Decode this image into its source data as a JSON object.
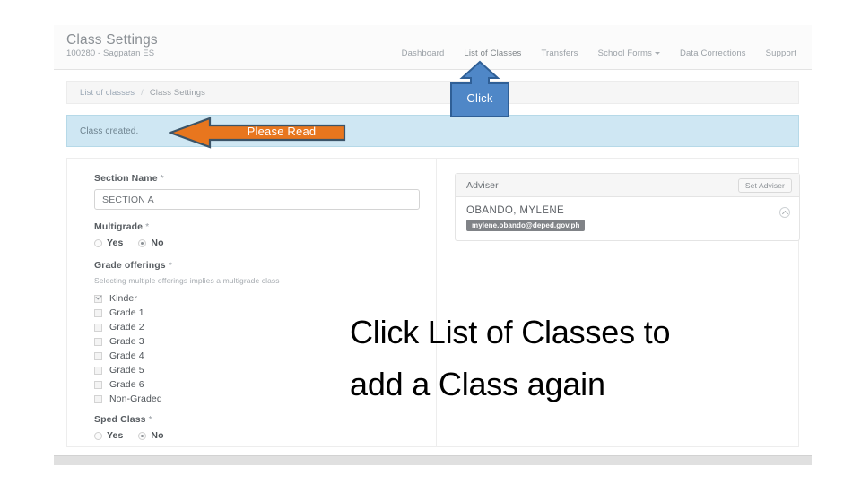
{
  "app": {
    "title": "Class Settings",
    "subtitle": "100280 - Sagpatan ES"
  },
  "nav": {
    "items": [
      {
        "label": "Dashboard",
        "active": false
      },
      {
        "label": "List of Classes",
        "active": true
      },
      {
        "label": "Transfers",
        "active": false
      },
      {
        "label": "School Forms",
        "active": false,
        "has_caret": true
      },
      {
        "label": "Data Corrections",
        "active": false
      },
      {
        "label": "Support",
        "active": false
      }
    ]
  },
  "breadcrumb": {
    "parent": "List of classes",
    "separator": "/",
    "current": "Class Settings"
  },
  "alert": {
    "text": "Class created.",
    "bg_color": "#cfe7f3",
    "border_color": "#b6d9e8"
  },
  "form": {
    "section_name_label": "Section Name",
    "required_mark": "*",
    "section_name_value": "SECTION A",
    "section_name_placeholder": "SECTION A",
    "multigrade_label": "Multigrade",
    "multigrade_options": [
      {
        "label": "Yes",
        "selected": false
      },
      {
        "label": "No",
        "selected": true
      }
    ],
    "grade_offerings_label": "Grade offerings",
    "grade_offerings_help": "Selecting multiple offerings implies a multigrade class",
    "grade_offerings": [
      {
        "label": "Kinder",
        "checked": true
      },
      {
        "label": "Grade 1",
        "checked": false
      },
      {
        "label": "Grade 2",
        "checked": false
      },
      {
        "label": "Grade 3",
        "checked": false
      },
      {
        "label": "Grade 4",
        "checked": false
      },
      {
        "label": "Grade 5",
        "checked": false
      },
      {
        "label": "Grade 6",
        "checked": false
      },
      {
        "label": "Non-Graded",
        "checked": false
      }
    ],
    "sped_class_label": "Sped Class",
    "sped_class_options": [
      {
        "label": "Yes",
        "selected": false
      },
      {
        "label": "No",
        "selected": true
      }
    ]
  },
  "adviser": {
    "panel_title": "Adviser",
    "set_button_label": "Set Adviser",
    "name": "OBANDO, MYLENE",
    "email": "mylene.obando@deped.gov.ph",
    "collapse_icon": "chevron-up-circle-icon"
  },
  "annotations": {
    "please_read": {
      "label": "Please Read",
      "fill_color": "#e8761e",
      "stroke_color": "#3b5468",
      "direction": "left"
    },
    "click_callout": {
      "label": "Click",
      "fill_color": "#4f87c7",
      "stroke_color": "#2f5f96",
      "direction": "up"
    },
    "instruction": {
      "line1": "Click List of Classes to",
      "line2": "add a Class again"
    }
  }
}
